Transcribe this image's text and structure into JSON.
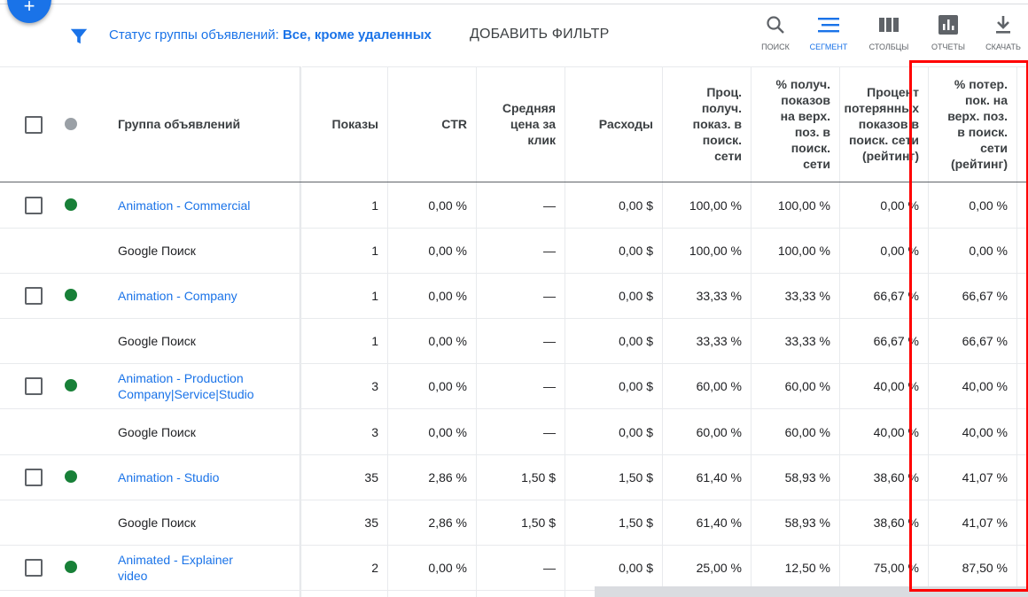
{
  "fab": {
    "icon": "plus-icon",
    "symbol": "+",
    "color": "#1a73e8"
  },
  "toolbar": {
    "filter_icon": "filter-icon",
    "status_prefix": "Статус группы объявлений:",
    "status_value": "Все, кроме удаленных",
    "add_filter": "ДОБАВИТЬ ФИЛЬТР",
    "tools": [
      {
        "icon": "search-icon",
        "label": "ПОИСК",
        "active": false
      },
      {
        "icon": "segment-icon",
        "label": "СЕГМЕНТ",
        "active": true
      },
      {
        "icon": "columns-icon",
        "label": "СТОЛБЦЫ",
        "active": false
      },
      {
        "icon": "reports-icon",
        "label": "ОТЧЕТЫ",
        "active": false
      },
      {
        "icon": "download-icon",
        "label": "СКАЧАТЬ",
        "active": false
      }
    ]
  },
  "table": {
    "headers": {
      "group": "Группа объявлений",
      "impressions": [
        "Показы"
      ],
      "ctr": [
        "CTR"
      ],
      "avg_cpc": [
        "Средняя",
        "цена за",
        "клик"
      ],
      "cost": [
        "Расходы"
      ],
      "search_imp_share": [
        "Проц.",
        "получ.",
        "показ. в",
        "поиск.",
        "сети"
      ],
      "top_imp_share": [
        "% получ.",
        "показов",
        "на верх.",
        "поз. в",
        "поиск.",
        "сети"
      ],
      "lost_rank": [
        "Процент",
        "потерянных",
        "показов в",
        "поиск. сети",
        "(рейтинг)"
      ],
      "lost_top_rank": [
        "% потер.",
        "пок. на",
        "верх. поз.",
        "в поиск.",
        "сети",
        "(рейтинг)"
      ]
    },
    "rows": [
      {
        "type": "group",
        "name": [
          "Animation - Commercial"
        ],
        "impressions": "1",
        "ctr": "0,00 %",
        "avg_cpc": "—",
        "cost": "0,00 $",
        "search_imp_share": "100,00 %",
        "top_imp_share": "100,00 %",
        "lost_rank": "0,00 %",
        "lost_top_rank": "0,00 %"
      },
      {
        "type": "segment",
        "name": [
          "Google Поиск"
        ],
        "impressions": "1",
        "ctr": "0,00 %",
        "avg_cpc": "—",
        "cost": "0,00 $",
        "search_imp_share": "100,00 %",
        "top_imp_share": "100,00 %",
        "lost_rank": "0,00 %",
        "lost_top_rank": "0,00 %"
      },
      {
        "type": "group",
        "name": [
          "Animation - Company"
        ],
        "impressions": "1",
        "ctr": "0,00 %",
        "avg_cpc": "—",
        "cost": "0,00 $",
        "search_imp_share": "33,33 %",
        "top_imp_share": "33,33 %",
        "lost_rank": "66,67 %",
        "lost_top_rank": "66,67 %"
      },
      {
        "type": "segment",
        "name": [
          "Google Поиск"
        ],
        "impressions": "1",
        "ctr": "0,00 %",
        "avg_cpc": "—",
        "cost": "0,00 $",
        "search_imp_share": "33,33 %",
        "top_imp_share": "33,33 %",
        "lost_rank": "66,67 %",
        "lost_top_rank": "66,67 %"
      },
      {
        "type": "group",
        "name": [
          "Animation - Production",
          "Company|Service|Studio"
        ],
        "impressions": "3",
        "ctr": "0,00 %",
        "avg_cpc": "—",
        "cost": "0,00 $",
        "search_imp_share": "60,00 %",
        "top_imp_share": "60,00 %",
        "lost_rank": "40,00 %",
        "lost_top_rank": "40,00 %"
      },
      {
        "type": "segment",
        "name": [
          "Google Поиск"
        ],
        "impressions": "3",
        "ctr": "0,00 %",
        "avg_cpc": "—",
        "cost": "0,00 $",
        "search_imp_share": "60,00 %",
        "top_imp_share": "60,00 %",
        "lost_rank": "40,00 %",
        "lost_top_rank": "40,00 %"
      },
      {
        "type": "group",
        "name": [
          "Animation - Studio"
        ],
        "impressions": "35",
        "ctr": "2,86 %",
        "avg_cpc": "1,50 $",
        "cost": "1,50 $",
        "search_imp_share": "61,40 %",
        "top_imp_share": "58,93 %",
        "lost_rank": "38,60 %",
        "lost_top_rank": "41,07 %"
      },
      {
        "type": "segment",
        "name": [
          "Google Поиск"
        ],
        "impressions": "35",
        "ctr": "2,86 %",
        "avg_cpc": "1,50 $",
        "cost": "1,50 $",
        "search_imp_share": "61,40 %",
        "top_imp_share": "58,93 %",
        "lost_rank": "38,60 %",
        "lost_top_rank": "41,07 %"
      },
      {
        "type": "group",
        "name": [
          "Animated - Explainer",
          "video"
        ],
        "impressions": "2",
        "ctr": "0,00 %",
        "avg_cpc": "—",
        "cost": "0,00 $",
        "search_imp_share": "25,00 %",
        "top_imp_share": "12,50 %",
        "lost_rank": "75,00 %",
        "lost_top_rank": "87,50 %"
      }
    ]
  },
  "colors": {
    "link": "#1a73e8",
    "status_enabled": "#188038",
    "status_header": "#9aa0a6",
    "highlight": "#ff0000"
  }
}
